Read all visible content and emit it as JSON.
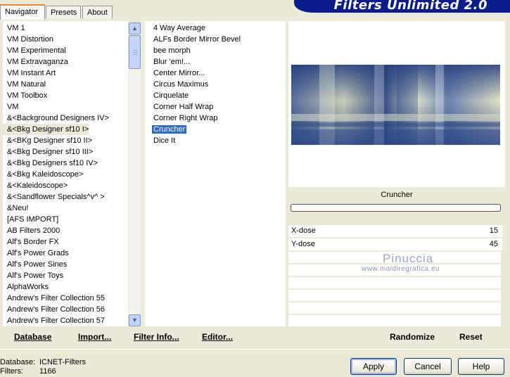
{
  "tabs": [
    "Navigator",
    "Presets",
    "About"
  ],
  "header": {
    "title": "Filters Unlimited 2.0"
  },
  "categories": [
    "VM 1",
    "VM Distortion",
    "VM Experimental",
    "VM Extravaganza",
    "VM Instant Art",
    "VM Natural",
    "VM Toolbox",
    "VM",
    "&<Background Designers IV>",
    "&<Bkg Designer sf10 I>",
    "&<BKg Designer sf10 II>",
    "&<Bkg Designer sf10 III>",
    "&<Bkg Designers sf10 IV>",
    "&<Bkg Kaleidoscope>",
    "&<Kaleidoscope>",
    "&<Sandflower Specials^v^ >",
    "&Neu!",
    "[AFS IMPORT]",
    "AB Filters 2000",
    "Alf's Border FX",
    "Alf's Power Grads",
    "Alf's Power Sines",
    "Alf's Power Toys",
    "AlphaWorks",
    "Andrew's Filter Collection 55",
    "Andrew's Filter Collection 56",
    "Andrew's Filter Collection 57"
  ],
  "selected_category": "&<Bkg Designer sf10 I>",
  "filters": [
    "4 Way Average",
    "ALFs Border Mirror Bevel",
    "bee morph",
    "Blur 'em!...",
    "Center Mirror...",
    "Circus Maximus",
    "Cirquelate",
    "Corner Half Wrap",
    "Corner Right Wrap",
    "Cruncher",
    "Dice It"
  ],
  "selected_filter": "Cruncher",
  "preview": {
    "filter_name": "Cruncher"
  },
  "params": [
    {
      "label": "X-dose",
      "value": "15"
    },
    {
      "label": "Y-dose",
      "value": "45"
    }
  ],
  "watermark": {
    "name": "Pinuccia",
    "url": "www.maidiregrafica.eu"
  },
  "bottom_links": {
    "database": "Database",
    "import": "Import...",
    "filter_info": "Filter Info...",
    "editor": "Editor...",
    "randomize": "Randomize",
    "reset": "Reset"
  },
  "status": {
    "database_label": "Database:",
    "database_value": "ICNET-Filters",
    "filters_label": "Filters:",
    "filters_value": "1166"
  },
  "buttons": {
    "apply": "Apply",
    "cancel": "Cancel",
    "help": "Help"
  },
  "colors": {
    "selection": "#316ac5",
    "banner": "#0b1c8c",
    "tab_accent": "#e68b2c"
  }
}
